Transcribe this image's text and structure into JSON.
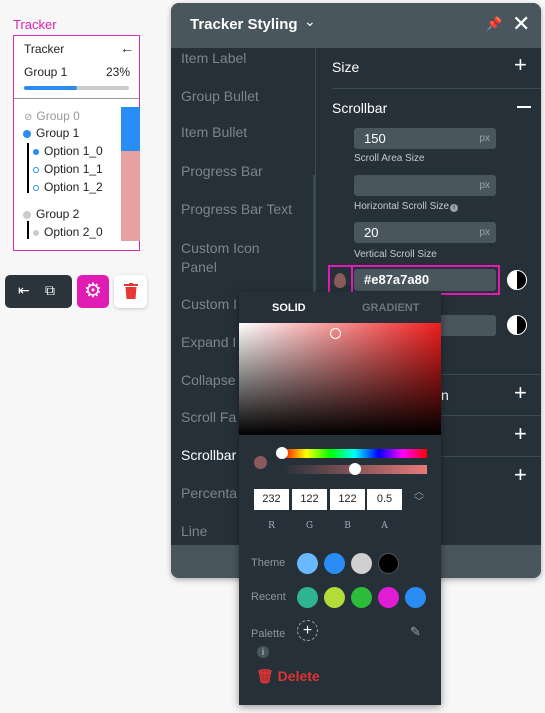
{
  "widget": {
    "label": "Tracker",
    "title": "Tracker",
    "back_icon": "arrow-left",
    "progress_label": "Group 1",
    "progress_percent": "23%",
    "progress_fill": 0.5,
    "groups": [
      {
        "label": "Group 0",
        "state": "done"
      },
      {
        "label": "Group 1",
        "state": "active",
        "options": [
          {
            "label": "Option 1_0",
            "state": "active"
          },
          {
            "label": "Option 1_1",
            "state": "open"
          },
          {
            "label": "Option 1_2",
            "state": "open"
          }
        ]
      },
      {
        "label": "Group 2",
        "state": "pending",
        "options": [
          {
            "label": "Option 2_0",
            "state": "pending"
          }
        ]
      }
    ],
    "scrollbar_thumb_color": "#2a8cf5",
    "scrollbar_track_color": "#e87a7a80"
  },
  "toolbar": {
    "icons": [
      "collapse-left-icon",
      "open-external-icon",
      "gear-icon",
      "trash-icon"
    ],
    "accent": "#e01cb4"
  },
  "panel": {
    "title": "Tracker Styling",
    "nav": [
      "Item Label",
      "Group Bullet",
      "Item Bullet",
      "Progress Bar",
      "Progress Bar Text",
      "Custom Icon Panel",
      "Custom I",
      "Expand I",
      "Collapse",
      "Scroll Fa",
      "Scrollbar",
      "Percenta",
      "Line"
    ],
    "active_nav": "Scrollbar",
    "size_label": "Size",
    "scrollbar_label": "Scrollbar",
    "scroll_area_size": "150",
    "scroll_area_label": "Scroll Area Size",
    "unit": "px",
    "horizontal_scroll_size": "",
    "horizontal_label": "Horizontal Scroll Size",
    "vertical_scroll_size": "20",
    "vertical_label": "Vertical Scroll Size",
    "color_value": "#e87a7a80",
    "partial_label": "n"
  },
  "picker": {
    "tab_solid": "SOLID",
    "tab_gradient": "GRADIENT",
    "r": "232",
    "g": "122",
    "b": "122",
    "a": "0.5",
    "labels": [
      "R",
      "G",
      "B",
      "A"
    ],
    "theme_label": "Theme",
    "theme": [
      "#6ab8ff",
      "#2a8cf5",
      "#d0d0d0",
      "#000000"
    ],
    "recent_label": "Recent",
    "recent": [
      "#2fb493",
      "#b2dc38",
      "#2dbb3a",
      "#e01cd4",
      "#2a8cf5"
    ],
    "palette_label": "Palette",
    "delete_label": "Delete"
  }
}
